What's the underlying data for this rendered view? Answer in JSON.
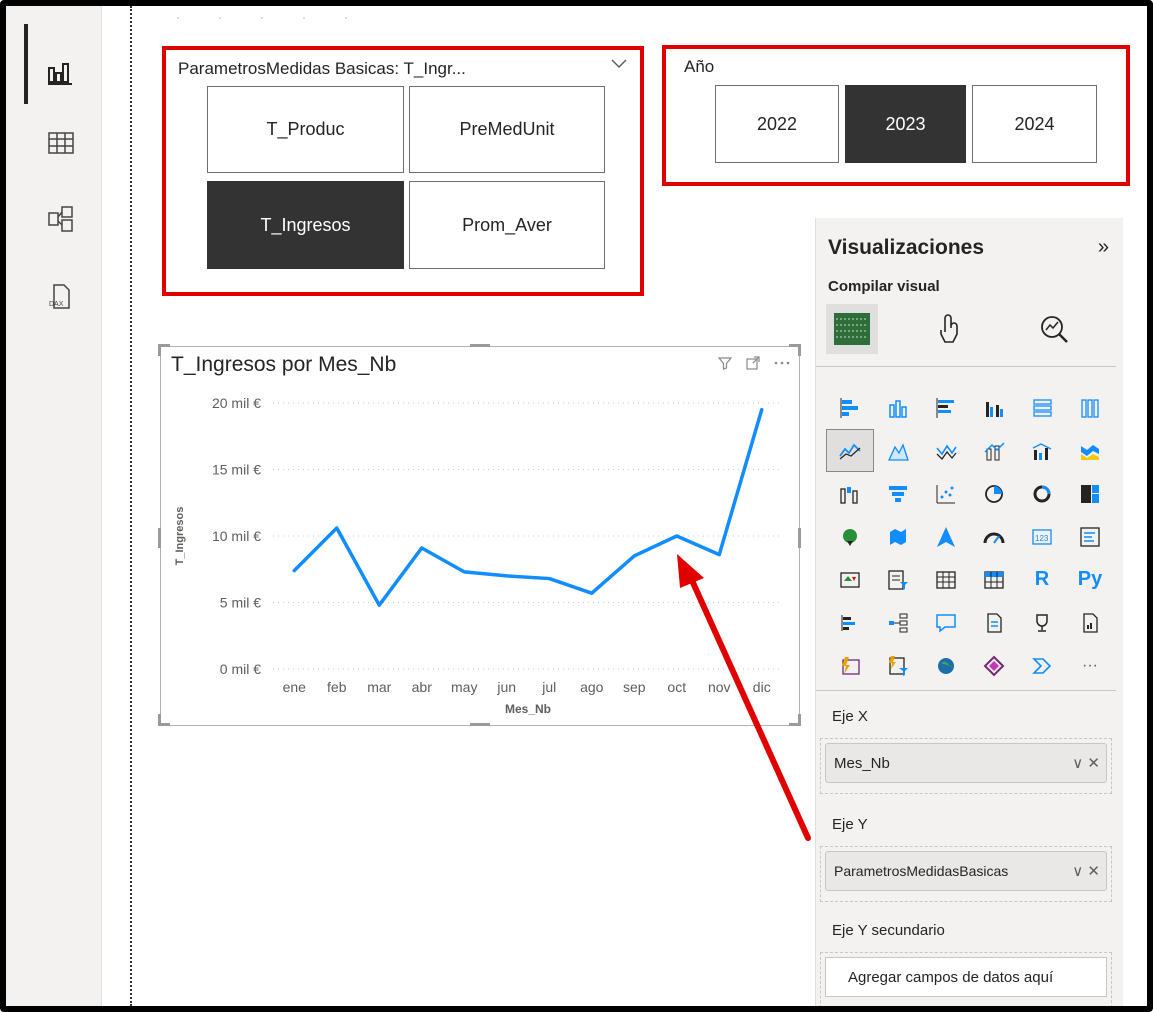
{
  "slicer_params": {
    "title": "ParametrosMedidas Basicas: T_Ingr...",
    "buttons": [
      "T_Produc",
      "PreMedUnit",
      "T_Ingresos",
      "Prom_Aver"
    ],
    "selected": "T_Ingresos"
  },
  "slicer_year": {
    "title": "Año",
    "buttons": [
      "2022",
      "2023",
      "2024"
    ],
    "selected": "2023"
  },
  "visual": {
    "title": "T_Ingresos por Mes_Nb",
    "icons": [
      "filter-icon",
      "focus-mode-icon",
      "more-options-icon"
    ]
  },
  "chart_data": {
    "type": "line",
    "title": "T_Ingresos por Mes_Nb",
    "xlabel": "Mes_Nb",
    "ylabel": "T_Ingresos",
    "categories": [
      "ene",
      "feb",
      "mar",
      "abr",
      "may",
      "jun",
      "jul",
      "ago",
      "sep",
      "oct",
      "nov",
      "dic"
    ],
    "series": [
      {
        "values": [
          7400,
          10600,
          4800,
          9100,
          7300,
          7000,
          6800,
          5700,
          8500,
          10000,
          8600,
          19500
        ]
      }
    ],
    "y_ticks": [
      "0 mil €",
      "5 mil €",
      "10 mil €",
      "15 mil €",
      "20 mil €"
    ],
    "ylim": [
      0,
      20000
    ],
    "grid": true,
    "line_color": "#118dff"
  },
  "pane": {
    "title": "Visualizaciones",
    "expand_glyph": "»",
    "subtitle": "Compilar visual",
    "tabs": [
      "build-visual-icon",
      "format-visual-icon",
      "analytics-icon"
    ],
    "well_x_label": "Eje X",
    "well_x_value": "Mes_Nb",
    "well_y_label": "Eje Y",
    "well_y_value": "ParametrosMedidasBasicas",
    "well_y2_label": "Eje Y secundario",
    "well_y2_placeholder": "Agregar campos de datos aquí",
    "grid_text": {
      "r": "R",
      "py": "Py",
      "ellipsis": "···"
    }
  },
  "annotation": {
    "color": "#e00000"
  }
}
